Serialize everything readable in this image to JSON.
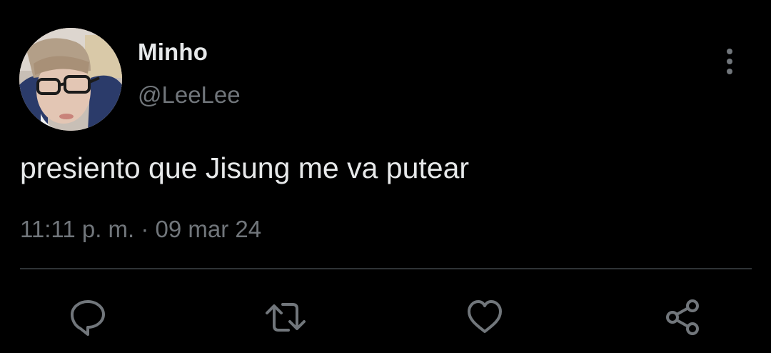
{
  "tweet": {
    "author": {
      "display_name": "Minho",
      "handle": "@LeeLee",
      "avatar_icon": "profile-photo"
    },
    "text": "presiento que Jisung me va putear",
    "time": "11:11 p. m.",
    "separator": "·",
    "date": "09 mar 24"
  },
  "actions": [
    {
      "name": "reply",
      "icon": "reply-icon"
    },
    {
      "name": "retweet",
      "icon": "retweet-icon"
    },
    {
      "name": "like",
      "icon": "heart-icon"
    },
    {
      "name": "share",
      "icon": "share-icon"
    }
  ],
  "colors": {
    "background": "#000000",
    "primary_text": "#e7e9ea",
    "secondary_text": "#71767b",
    "divider": "#2f3336"
  }
}
